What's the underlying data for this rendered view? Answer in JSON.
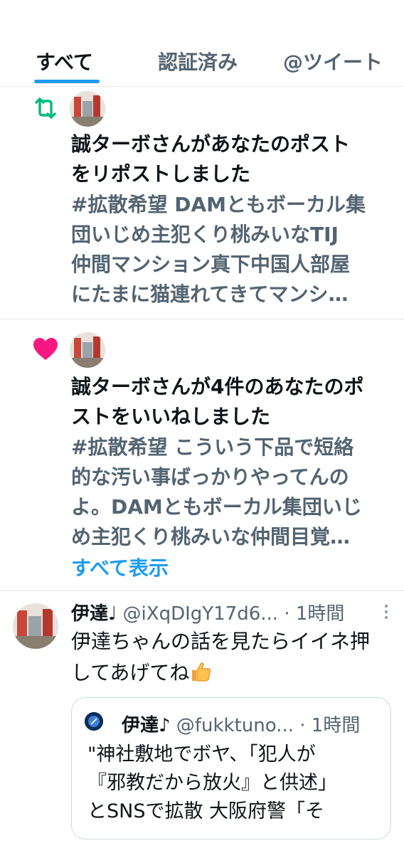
{
  "tabs": [
    {
      "label": "すべて",
      "active": true
    },
    {
      "label": "認証済み",
      "active": false
    },
    {
      "label": "@ツイート",
      "active": false
    }
  ],
  "colors": {
    "accent": "#1d9bf0",
    "repost": "#00ba7c",
    "like": "#f91880",
    "muted": "#536471"
  },
  "notifications": [
    {
      "type": "repost",
      "icon": "repost-icon",
      "text_line1": "誠ターボさんがあなたのポスト",
      "text_line2": "をリポストしました",
      "preview_lines": [
        "#拡散希望 DAMともボーカル集",
        "団いじめ主犯くり桃みいなTIJ",
        "仲間マンション真下中国人部屋",
        "にたまに猫連れてきてマンシ…"
      ]
    },
    {
      "type": "like",
      "icon": "heart-icon",
      "text_line1": "誠ターボさんが4件のあなたのポ",
      "text_line2": "ストをいいねしました",
      "preview_lines": [
        "#拡散希望 こういう下品で短絡",
        "的な汚い事ばっかりやってんの",
        "よ。DAMともボーカル集団いじ",
        "め主犯くり桃みいな仲間目覚…"
      ],
      "show_all": "すべて表示"
    }
  ],
  "tweet": {
    "name": "伊達♩",
    "handle": "@iXqDIgY17d6...",
    "dot": "·",
    "time": "1時間",
    "body_line1": "伊達ちゃんの話を見たらイイネ押",
    "body_line2": "してあげてね",
    "quote": {
      "name": "伊達♪",
      "handle": "@fukktuno...",
      "dot": "·",
      "time": "1時間",
      "lines": [
        "\"神社敷地でボヤ、「犯人が",
        "『邪教だから放火』と供述」",
        "とSNSで拡散 大阪府警「そ"
      ]
    }
  }
}
